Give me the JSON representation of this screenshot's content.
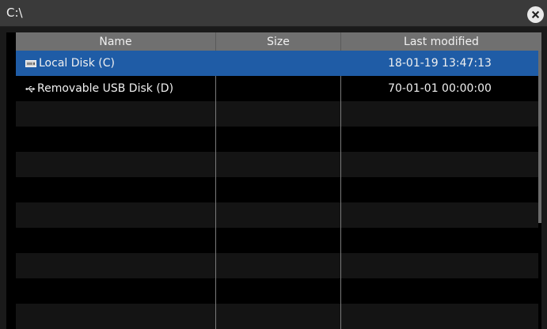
{
  "window": {
    "path": "C:\\"
  },
  "table": {
    "headers": {
      "name": "Name",
      "size": "Size",
      "last_modified": "Last modified"
    },
    "rows": [
      {
        "icon": "disk-icon",
        "name": "Local Disk (C)",
        "size": "",
        "last_modified": "18-01-19 13:47:13",
        "selected": true
      },
      {
        "icon": "usb-icon",
        "name": "Removable USB Disk (D)",
        "size": "",
        "last_modified": "70-01-01 00:00:00",
        "selected": false
      }
    ]
  },
  "colors": {
    "selection": "#1f5ca6",
    "header": "#707070",
    "titlebar": "#3a3a3a"
  }
}
